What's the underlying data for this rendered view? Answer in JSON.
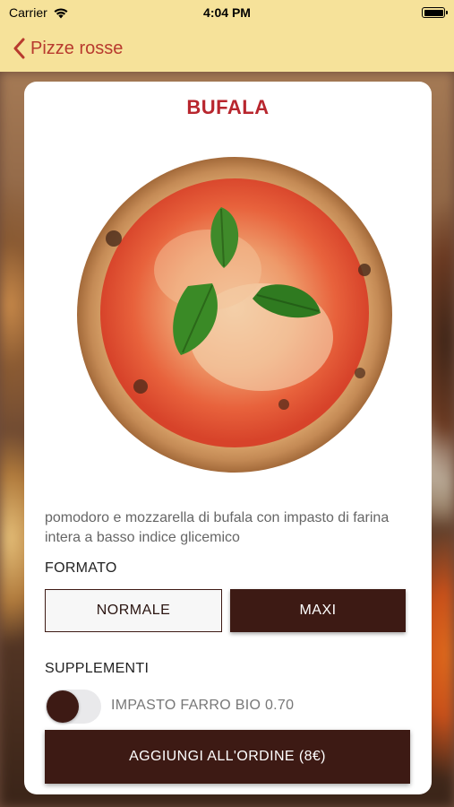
{
  "status": {
    "carrier": "Carrier",
    "time": "4:04 PM",
    "battery_level": 1.0
  },
  "nav": {
    "back_label": "Pizze rosse"
  },
  "product": {
    "name": "BUFALA",
    "image": "pizza-bufala",
    "description": "pomodoro e mozzarella di bufala con impasto di farina intera a basso indice glicemico"
  },
  "formato": {
    "label": "FORMATO",
    "options": [
      "NORMALE",
      "MAXI"
    ],
    "selected": "MAXI"
  },
  "supplementi": {
    "label": "SUPPLEMENTI",
    "items": [
      {
        "label": "IMPASTO FARRO BIO 0.70",
        "enabled": false
      }
    ]
  },
  "cta": {
    "label": "AGGIUNGI ALL'ORDINE (8€)"
  },
  "colors": {
    "accent": "#b8262e",
    "brand_dark": "#3d1a14",
    "navbar": "#f6e29a"
  }
}
